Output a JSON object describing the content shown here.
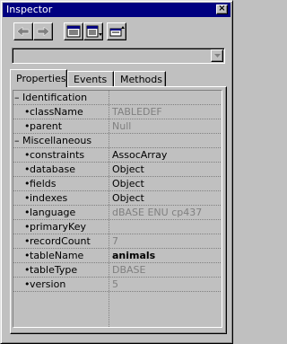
{
  "window": {
    "title": "Inspector",
    "close_glyph": "×"
  },
  "toolbar": {
    "buttons": [
      {
        "name": "back-arrow-icon",
        "enabled": false
      },
      {
        "name": "forward-arrow-icon",
        "enabled": false
      },
      {
        "name": "alphabetical-view-icon",
        "enabled": true
      },
      {
        "name": "categorized-view-icon",
        "enabled": true
      },
      {
        "name": "expand-object-icon",
        "enabled": true
      }
    ]
  },
  "object_selector": {
    "value": ""
  },
  "tabs": [
    "Properties",
    "Events",
    "Methods"
  ],
  "active_tab": "Properties",
  "properties": {
    "cat1": {
      "toggle": "–",
      "label": "Identification"
    },
    "rows": [
      {
        "name": "className",
        "value": "TABLEDEF"
      },
      {
        "name": "parent",
        "value": "Null"
      }
    ],
    "cat2": {
      "toggle": "–",
      "label": "Miscellaneous"
    },
    "rows2": [
      {
        "name": "constraints",
        "value": "AssocArray"
      },
      {
        "name": "database",
        "value": "Object"
      },
      {
        "name": "fields",
        "value": "Object"
      },
      {
        "name": "indexes",
        "value": "Object"
      },
      {
        "name": "language",
        "value": "dBASE ENU cp437"
      },
      {
        "name": "primaryKey",
        "value": ""
      },
      {
        "name": "recordCount",
        "value": "7"
      },
      {
        "name": "tableName",
        "value": "animals"
      },
      {
        "name": "tableType",
        "value": "DBASE"
      },
      {
        "name": "version",
        "value": "5"
      }
    ]
  },
  "colors": {
    "titlebar": "#000080",
    "face": "#c0c0c0",
    "readonly_value": "#808080"
  }
}
